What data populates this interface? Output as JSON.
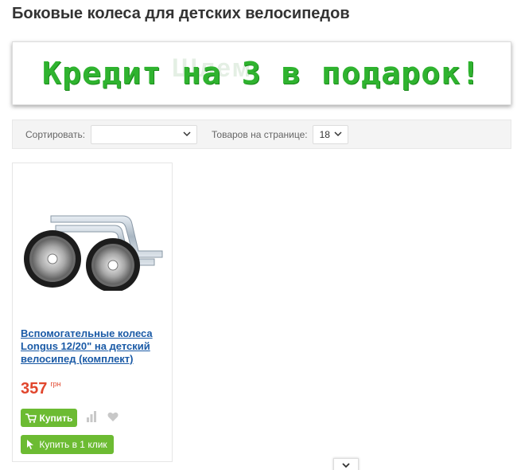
{
  "page": {
    "title": "Боковые колеса для детских велосипедов"
  },
  "banner": {
    "text": "Кредит на 3 в подарок!",
    "watermark": "Шлем",
    "color": "#2fb32f"
  },
  "toolbar": {
    "sort_label": "Сортировать:",
    "sort_value": "",
    "per_page_label": "Товаров на странице:",
    "per_page_value": "18"
  },
  "products": [
    {
      "title": "Вспомогательные колеса Longus 12/20\" на детский велосипед (комплект)",
      "price": "357",
      "currency": "грн",
      "buy_label": "Купить",
      "one_click_label": "Купить в 1 клик"
    }
  ],
  "colors": {
    "accent_green": "#6cbb32",
    "price_red": "#e1462d",
    "link_blue": "#1a5aa6"
  },
  "icons": [
    "chevron-down-icon",
    "cart-icon",
    "compare-icon",
    "heart-icon",
    "cursor-icon"
  ]
}
